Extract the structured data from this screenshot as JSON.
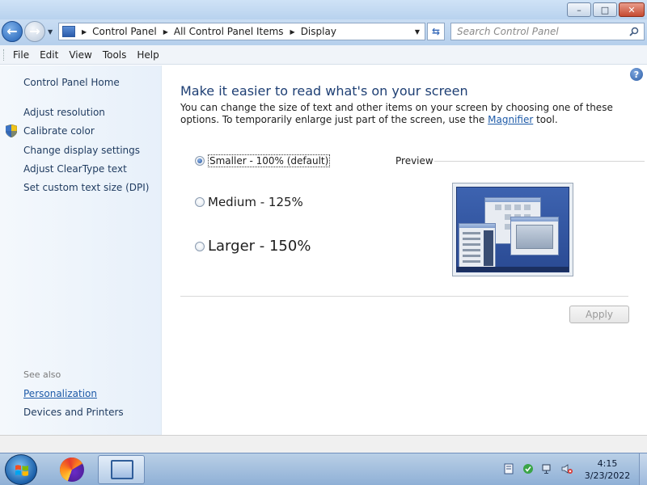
{
  "window": {
    "buttons": {
      "minimize": "–",
      "maximize": "□",
      "close": "✕"
    }
  },
  "address": {
    "crumbs": [
      "Control Panel",
      "All Control Panel Items",
      "Display"
    ]
  },
  "search": {
    "placeholder": "Search Control Panel"
  },
  "menu": [
    "File",
    "Edit",
    "View",
    "Tools",
    "Help"
  ],
  "sidebar": {
    "home": "Control Panel Home",
    "tasks": [
      "Adjust resolution",
      "Calibrate color",
      "Change display settings",
      "Adjust ClearType text",
      "Set custom text size (DPI)"
    ],
    "see_also_label": "See also",
    "see_also": [
      "Personalization",
      "Devices and Printers"
    ]
  },
  "main": {
    "title": "Make it easier to read what's on your screen",
    "description_pre": "You can change the size of text and other items on your screen by choosing one of these options. To temporarily enlarge just part of the screen, use the ",
    "magnifier_link": "Magnifier",
    "description_post": " tool.",
    "options": [
      {
        "label": "Smaller - 100% (default)",
        "checked": true
      },
      {
        "label": "Medium - 125%",
        "checked": false
      },
      {
        "label": "Larger - 150%",
        "checked": false
      }
    ],
    "preview_label": "Preview",
    "apply_label": "Apply",
    "help_label": "?"
  },
  "taskbar": {
    "time": "4:15",
    "date": "3/23/2022",
    "pinned": [
      "firefox-icon",
      "control-panel-icon"
    ]
  },
  "colors": {
    "title_blue": "#1e3f74",
    "link_blue": "#1d5aa8",
    "sidebar_bg": "#e7f0fa"
  }
}
